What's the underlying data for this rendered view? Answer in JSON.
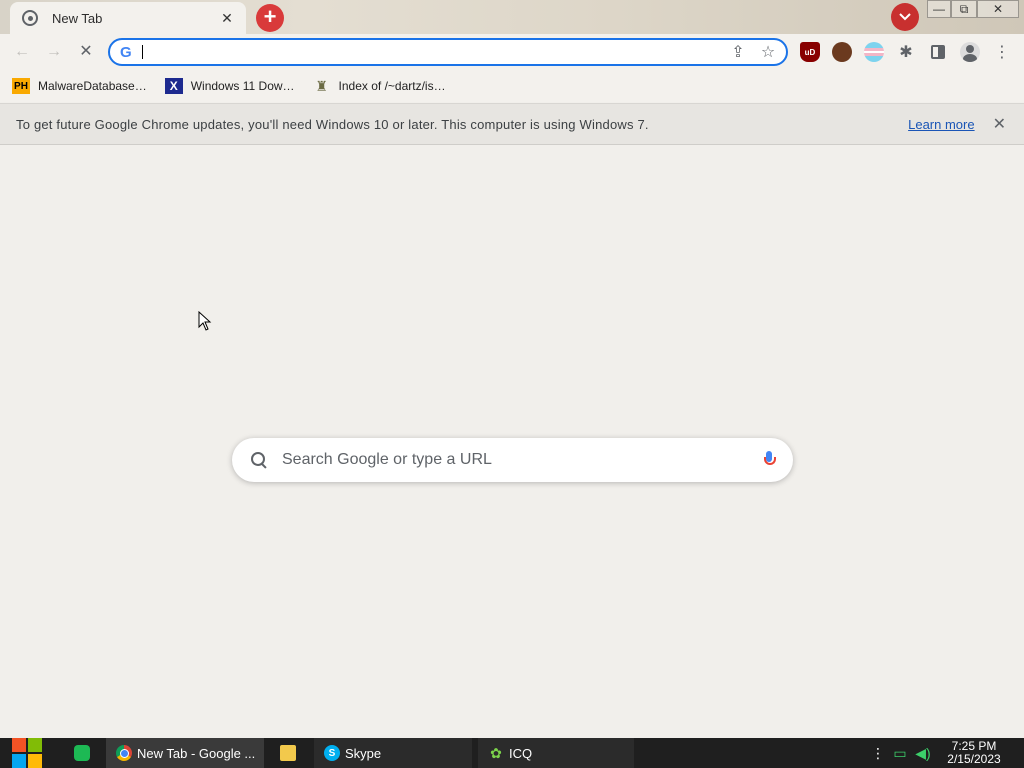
{
  "tab": {
    "title": "New Tab"
  },
  "window": {
    "minimize_glyph": "—",
    "maximize_glyph": "⧉",
    "close_glyph": "✕"
  },
  "toolbar": {
    "back_glyph": "←",
    "forward_glyph": "→",
    "reload_glyph": "✕",
    "omnibox_value": "",
    "share_glyph": "⇪",
    "bookmark_glyph": "☆",
    "ublock_label": "uD",
    "puzzle_glyph": "✱",
    "menu_glyph": "⋮"
  },
  "bookmarks": [
    {
      "label": "MalwareDatabase…",
      "icon_text": "PH",
      "icon": "pornhub-icon"
    },
    {
      "label": "Windows 11 Dow…",
      "icon_text": "X",
      "icon": "x-icon"
    },
    {
      "label": "Index of /~dartz/is…",
      "icon_text": "♜",
      "icon": "folder-tree-icon"
    }
  ],
  "infobar": {
    "message": "To get future Google Chrome updates, you'll need Windows 10 or later. This computer is using Windows 7.",
    "link": "Learn more",
    "close_glyph": "✕"
  },
  "search": {
    "placeholder": "Search Google or type a URL"
  },
  "taskbar": {
    "chrome_label": "New Tab - Google ...",
    "skype_label": "Skype",
    "icq_label": "ICQ",
    "icq_glyph": "✿",
    "tray_dots": "⋮",
    "network_glyph": "▭",
    "volume_glyph": "◀)",
    "time": "7:25 PM",
    "date": "2/15/2023"
  },
  "colors": {
    "accent": "#1a73e8",
    "newtab_red": "#d93a3a",
    "taskbar": "#1f1f1f"
  }
}
